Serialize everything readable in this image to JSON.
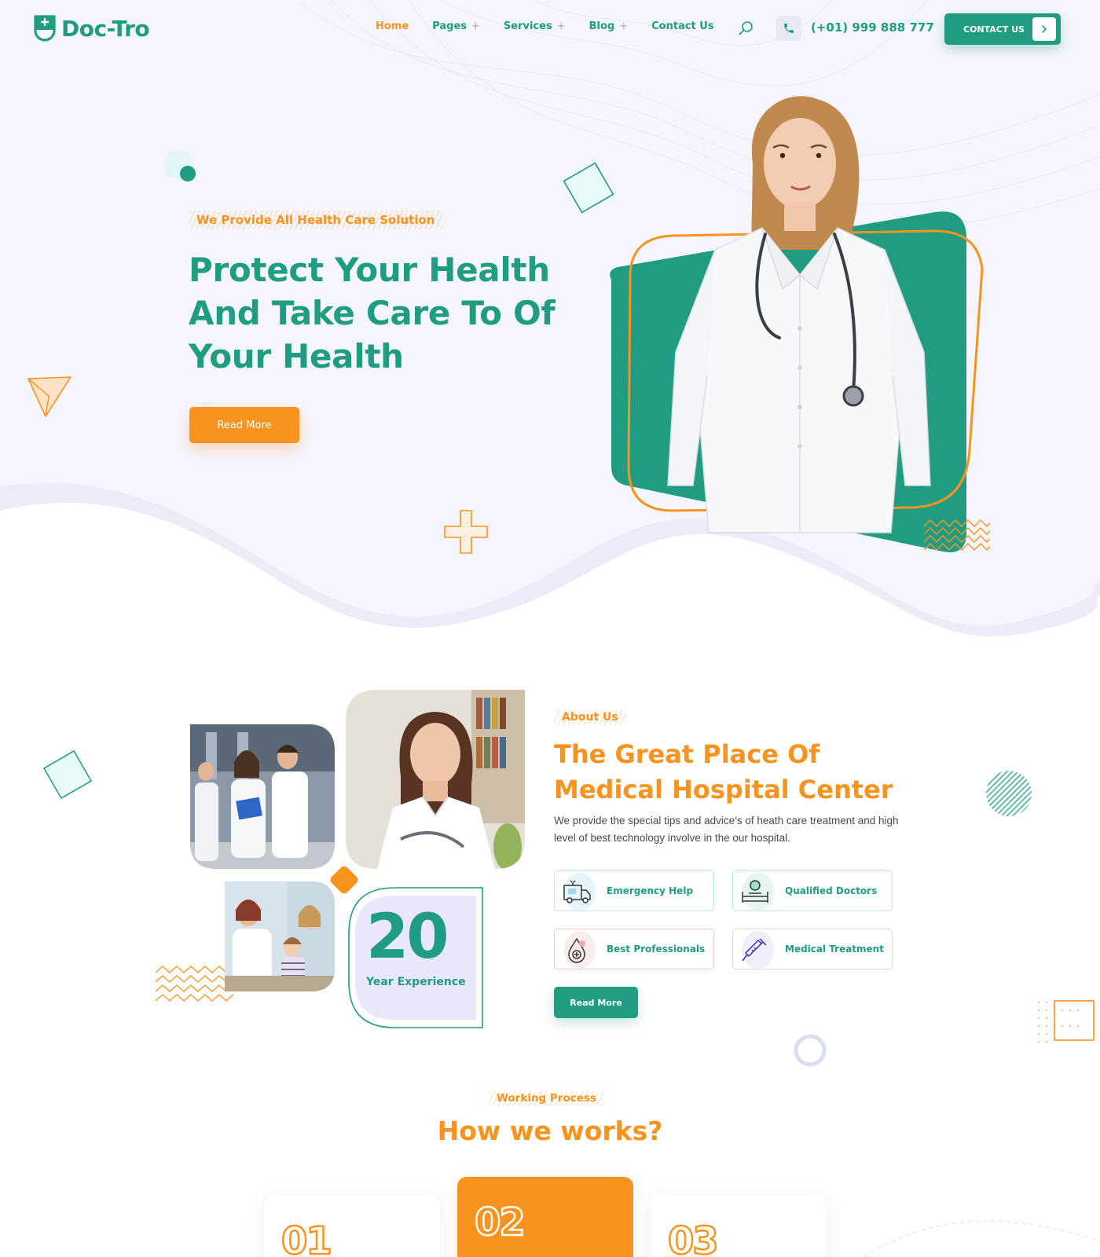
{
  "brand": {
    "name": "Doc-Tro"
  },
  "nav": {
    "items": [
      {
        "label": "Home",
        "active": true,
        "has_submenu": false
      },
      {
        "label": "Pages",
        "active": false,
        "has_submenu": true
      },
      {
        "label": "Services",
        "active": false,
        "has_submenu": true
      },
      {
        "label": "Blog",
        "active": false,
        "has_submenu": true
      },
      {
        "label": "Contact Us",
        "active": false,
        "has_submenu": false
      }
    ],
    "submenu_glyph": "+",
    "search_icon": "search-icon"
  },
  "header": {
    "phone": "(+01) 999 888 777",
    "cta_label": "CONTACT US"
  },
  "hero": {
    "subtitle": "We Provide All Health Care Solution",
    "title_line1": "Protect Your Health",
    "title_line2": "And Take Care To Of",
    "title_line3": "Your Health",
    "button_label": "Read More"
  },
  "about": {
    "tag": "About Us",
    "title_line1": "The Great Place Of",
    "title_line2": "Medical Hospital Center",
    "description": "We provide the special tips and advice’s of heath care treatment and high level of best technology involve in the our hospital.",
    "experience_number": "20",
    "experience_label": "Year Experience",
    "features": [
      {
        "label": "Emergency Help",
        "icon": "ambulance-icon"
      },
      {
        "label": "Qualified Doctors",
        "icon": "hospital-bed-icon"
      },
      {
        "label": "Best Professionals",
        "icon": "blood-drop-icon"
      },
      {
        "label": "Medical Treatment",
        "icon": "syringe-icon"
      }
    ],
    "button_label": "Read More"
  },
  "process": {
    "tag": "Working Process",
    "title": "How we works?",
    "steps": [
      {
        "number": "01",
        "active": false
      },
      {
        "number": "02",
        "active": true
      },
      {
        "number": "03",
        "active": false
      }
    ]
  },
  "colors": {
    "primary": "#1f9c81",
    "accent": "#f7931e",
    "hero_bg": "#f5f5fd"
  }
}
